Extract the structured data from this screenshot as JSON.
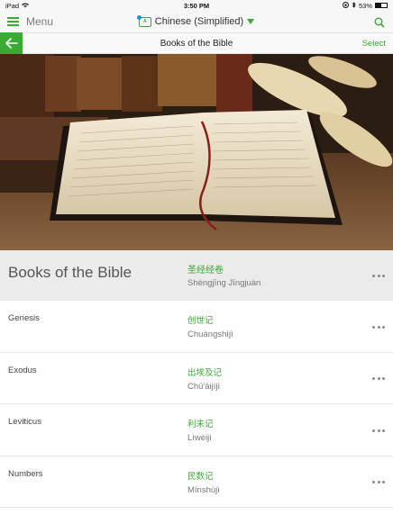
{
  "status": {
    "device": "iPad",
    "time": "3:50 PM",
    "battery": "53%"
  },
  "topbar": {
    "menu_label": "Menu",
    "language": "Chinese (Simplified)",
    "lang_icon_text": "A"
  },
  "navbar": {
    "title": "Books of the Bible",
    "select_label": "Select"
  },
  "header": {
    "en": "Books of the Bible",
    "zh": "圣经经卷",
    "pinyin": "Shèngjīng Jīngjuàn"
  },
  "books": [
    {
      "en": "Genesis",
      "zh": "创世记",
      "pinyin": "Chuàngshìjì"
    },
    {
      "en": "Exodus",
      "zh": "出埃及记",
      "pinyin": "Chū'āijíjì"
    },
    {
      "en": "Leviticus",
      "zh": "利未记",
      "pinyin": "Lìwèijì"
    },
    {
      "en": "Numbers",
      "zh": "民数记",
      "pinyin": "Mínshùjì"
    }
  ],
  "colors": {
    "accent": "#3aaa35",
    "header_bg": "#ebebeb"
  },
  "icons": [
    "hamburger-icon",
    "language-icon",
    "search-icon",
    "back-arrow-icon",
    "more-icon"
  ]
}
